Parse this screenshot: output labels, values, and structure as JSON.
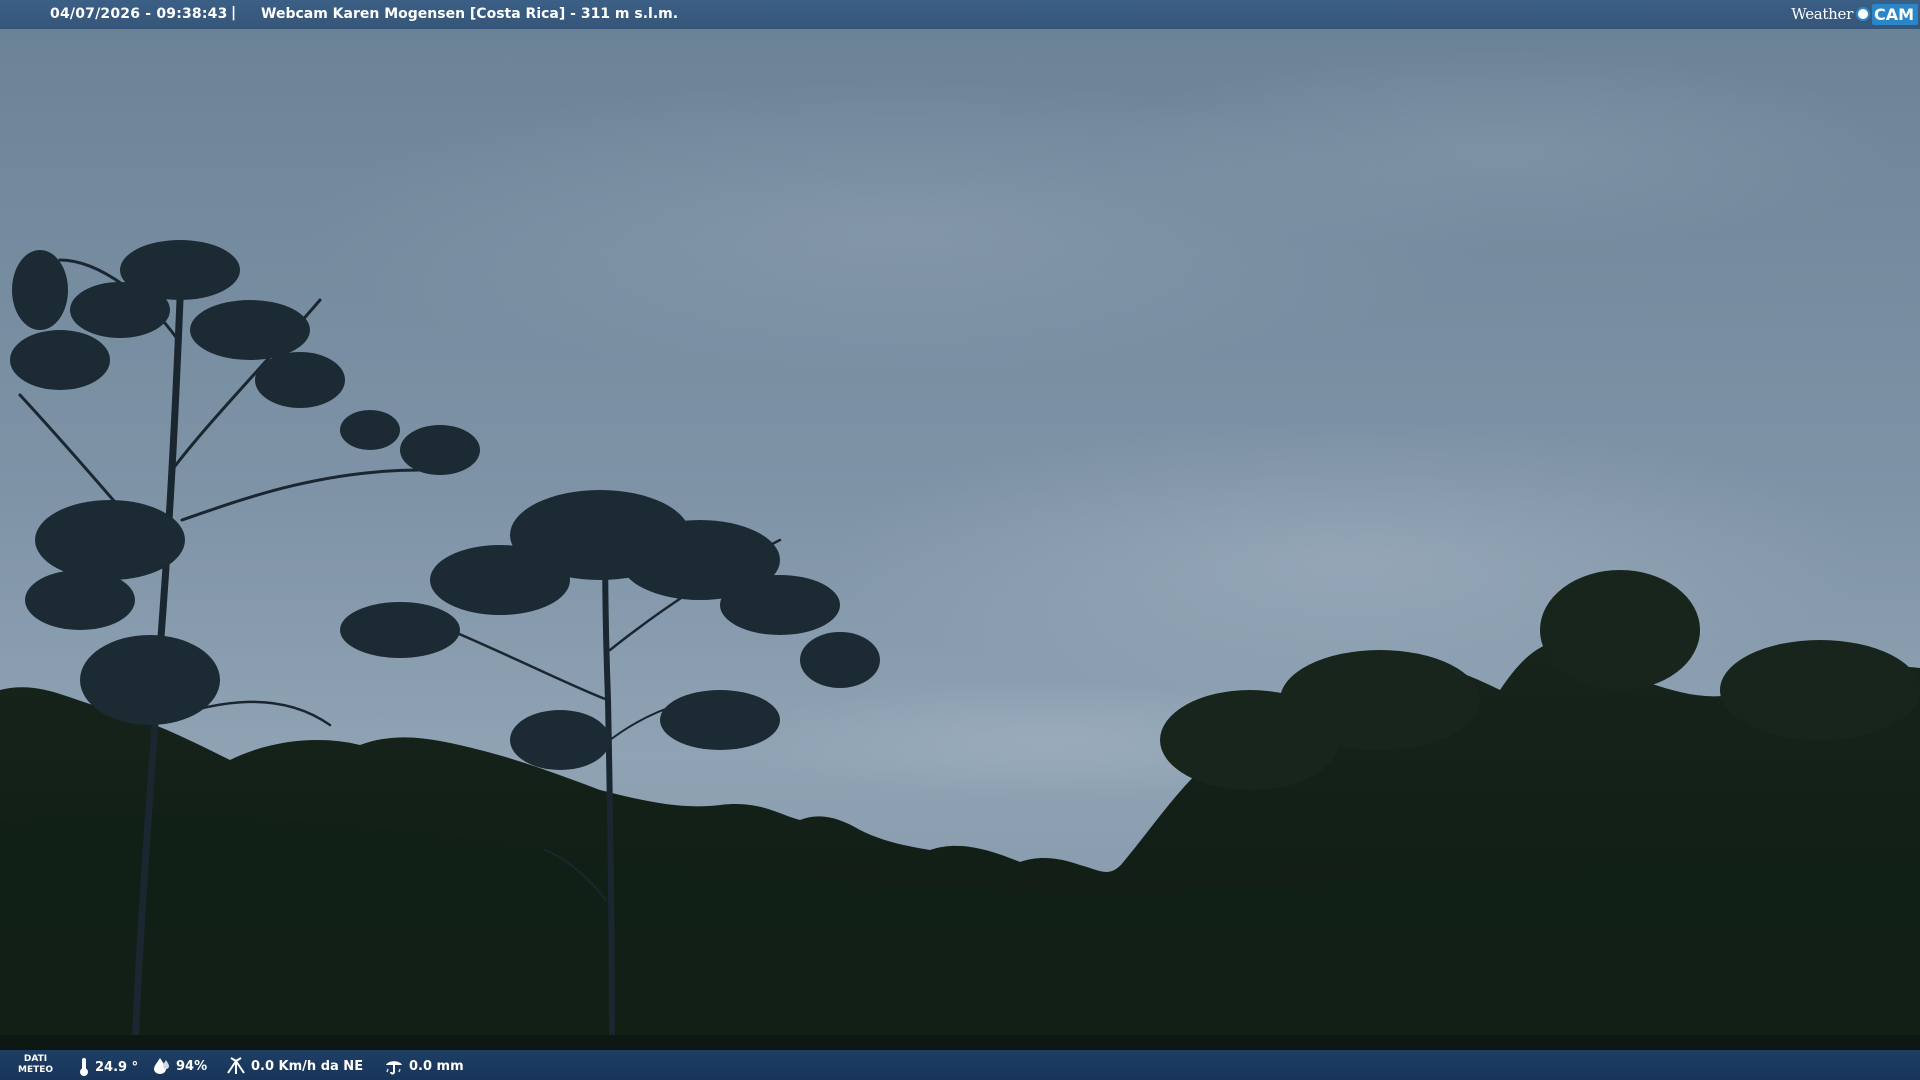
{
  "header": {
    "timestamp": "04/07/2026 - 09:38:43",
    "separator": "|",
    "title": "Webcam Karen Mogensen [Costa Rica]  - 311 m s.l.m.",
    "logo_word": "Weather",
    "logo_cam": "CAM"
  },
  "footer": {
    "dati_line1": "DATI",
    "dati_line2": "METEO",
    "temperature": "24.9 °",
    "humidity": "94%",
    "wind": "0.0 Km/h da NE",
    "rain": "0.0 mm"
  },
  "colors": {
    "sky_top": "#6f8598",
    "sky_bottom": "#8a9fb1",
    "forest": "#0f1c14",
    "bar": "#355678",
    "logo_accent": "#2b86c8"
  },
  "icons": [
    "thermometer-icon",
    "humidity-drop-icon",
    "wind-icon",
    "rain-icon"
  ]
}
